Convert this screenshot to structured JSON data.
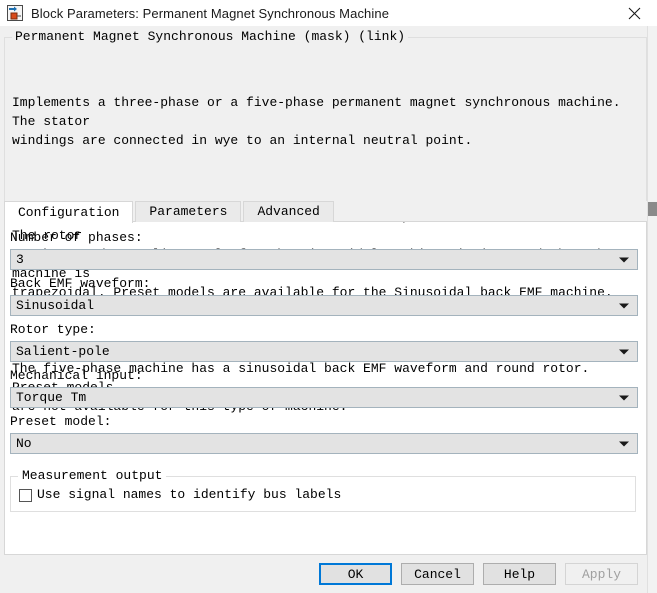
{
  "window": {
    "title": "Block Parameters: Permanent Magnet Synchronous Machine",
    "icon": "simulink-block-icon",
    "close_label": "×"
  },
  "description": {
    "title": "Permanent Magnet Synchronous Machine (mask) (link)",
    "paragraphs": [
      "Implements a three-phase or a five-phase permanent magnet synchronous machine. The stator\nwindings are connected in wye to an internal neutral point.",
      "The three-phase machine can have sinusoidal or trapezoidal back EMF waveform. The rotor\ncan be round or salient-pole for the sinusoidal machine, it is round when the machine is\ntrapezoidal. Preset models are available for the Sinusoidal back EMF machine.",
      "The five-phase machine has a sinusoidal back EMF waveform and round rotor. Preset models\nare not available for this type of machine."
    ]
  },
  "tabs": [
    {
      "label": "Configuration",
      "active": true
    },
    {
      "label": "Parameters",
      "active": false
    },
    {
      "label": "Advanced",
      "active": false
    }
  ],
  "fields": [
    {
      "label": "Number of phases:",
      "value": "3"
    },
    {
      "label": "Back EMF waveform:",
      "value": "Sinusoidal"
    },
    {
      "label": "Rotor type:",
      "value": "Salient-pole"
    },
    {
      "label": "Mechanical input:",
      "value": "Torque Tm"
    },
    {
      "label": "Preset model:",
      "value": "No"
    }
  ],
  "measurement": {
    "group_title": "Measurement output",
    "checkbox_label": "Use signal names to identify bus labels",
    "checked": false
  },
  "buttons": [
    {
      "label": "OK",
      "state": "default"
    },
    {
      "label": "Cancel",
      "state": "normal"
    },
    {
      "label": "Help",
      "state": "normal"
    },
    {
      "label": "Apply",
      "state": "disabled"
    }
  ],
  "colors": {
    "accent": "#0078d7",
    "window_bg": "#f0f0f0",
    "panel_bg": "#ffffff",
    "combo_bg": "#e3e3e3"
  }
}
